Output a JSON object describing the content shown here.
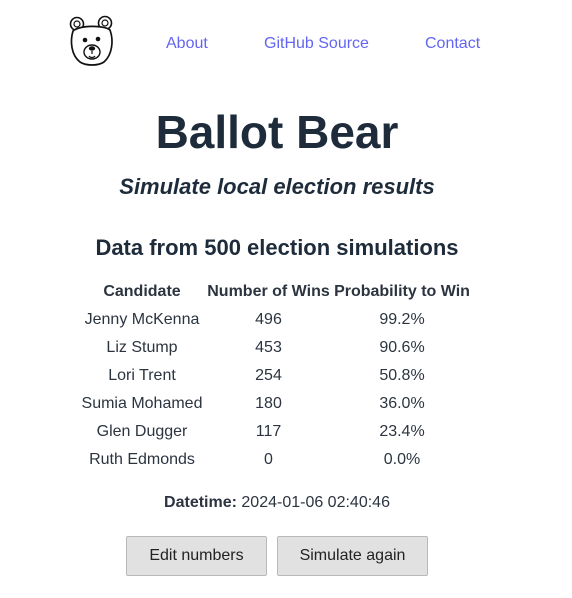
{
  "nav": {
    "logo_icon": "bear-face-icon",
    "links": [
      {
        "label": "About"
      },
      {
        "label": "GitHub Source"
      },
      {
        "label": "Contact"
      }
    ],
    "link_color": "#6366f1"
  },
  "header": {
    "title": "Ballot Bear",
    "subtitle": "Simulate local election results"
  },
  "results": {
    "heading": "Data from 500 election simulations",
    "columns": [
      "Candidate",
      "Number of Wins",
      "Probability to Win"
    ],
    "rows": [
      {
        "candidate": "Jenny McKenna",
        "wins": "496",
        "probability": "99.2%"
      },
      {
        "candidate": "Liz Stump",
        "wins": "453",
        "probability": "90.6%"
      },
      {
        "candidate": "Lori Trent",
        "wins": "254",
        "probability": "50.8%"
      },
      {
        "candidate": "Sumia Mohamed",
        "wins": "180",
        "probability": "36.0%"
      },
      {
        "candidate": "Glen Dugger",
        "wins": "117",
        "probability": "23.4%"
      },
      {
        "candidate": "Ruth Edmonds",
        "wins": "0",
        "probability": "0.0%"
      }
    ]
  },
  "datetime": {
    "label": "Datetime:",
    "value": "2024-01-06 02:40:46"
  },
  "actions": {
    "edit_label": "Edit numbers",
    "simulate_label": "Simulate again"
  }
}
